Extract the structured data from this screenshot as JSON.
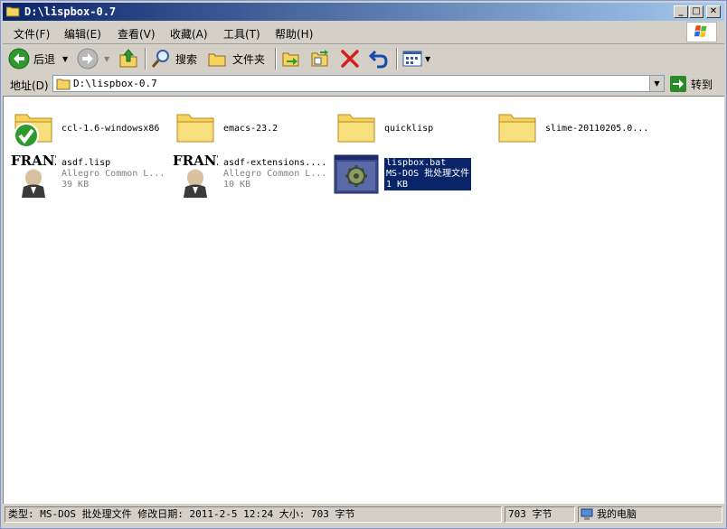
{
  "window": {
    "title": "D:\\lispbox-0.7"
  },
  "menu": [
    {
      "label": "文件(F)"
    },
    {
      "label": "编辑(E)"
    },
    {
      "label": "查看(V)"
    },
    {
      "label": "收藏(A)"
    },
    {
      "label": "工具(T)"
    },
    {
      "label": "帮助(H)"
    }
  ],
  "toolbar": {
    "back_label": "后退",
    "search_label": "搜索",
    "folders_label": "文件夹"
  },
  "address": {
    "label": "地址(D)",
    "value": "D:\\lispbox-0.7",
    "go_label": "转到"
  },
  "files": [
    {
      "name": "ccl-1.6-windowsx86",
      "type": "folder",
      "overlay": "check"
    },
    {
      "name": "emacs-23.2",
      "type": "folder"
    },
    {
      "name": "quicklisp",
      "type": "folder"
    },
    {
      "name": "slime-20110205.0...",
      "type": "folder"
    },
    {
      "name": "asdf.lisp",
      "desc": "Allegro Common L...",
      "size": "39 KB",
      "type": "franz"
    },
    {
      "name": "asdf-extensions....",
      "desc": "Allegro Common L...",
      "size": "10 KB",
      "type": "franz"
    },
    {
      "name": "lispbox.bat",
      "desc": "MS-DOS 批处理文件",
      "size": "1 KB",
      "type": "bat",
      "selected": true
    }
  ],
  "status": {
    "info": "类型: MS-DOS 批处理文件 修改日期: 2011-2-5 12:24 大小: 703 字节",
    "size": "703 字节",
    "zone": "我的电脑"
  },
  "icons": {
    "folder": "folder-icon",
    "franz": "franz-lisp-icon",
    "bat": "batch-file-icon",
    "back": "back-arrow-icon",
    "forward": "forward-arrow-icon",
    "up": "up-folder-icon",
    "search": "search-icon",
    "folders": "folders-icon",
    "move": "move-to-icon",
    "copy": "copy-to-icon",
    "delete": "delete-x-icon",
    "undo": "undo-icon",
    "views": "views-icon",
    "go": "go-arrow-icon",
    "computer": "my-computer-icon"
  },
  "colors": {
    "title_active": "#0a246a",
    "selection": "#0a246a",
    "folder_yellow": "#f4d35e",
    "delete_red": "#d02020",
    "go_green": "#2a8a2a"
  }
}
